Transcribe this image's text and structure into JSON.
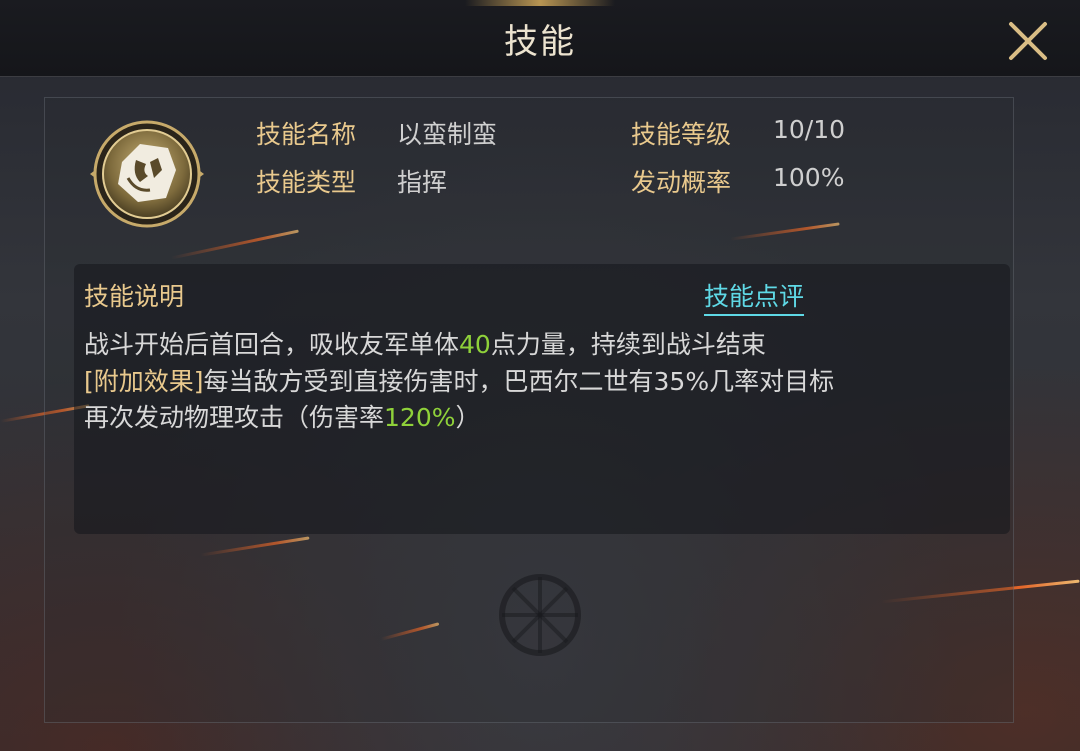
{
  "header": {
    "title": "技能",
    "close_icon": "close-icon"
  },
  "skill": {
    "icon": "skill-emblem-icon",
    "name_label": "技能名称",
    "name_value": "以蛮制蛮",
    "level_label": "技能等级",
    "level_value": "10/10",
    "type_label": "技能类型",
    "type_value": "指挥",
    "rate_label": "发动概率",
    "rate_value": "100%"
  },
  "description": {
    "title": "技能说明",
    "review_link": "技能点评",
    "line1_a": "战斗开始后首回合，吸收友军单体",
    "line1_b": "40",
    "line1_c": "点力量，持续到战斗结束",
    "line2_tag": "[附加效果]",
    "line2_text": "每当敌方受到直接伤害时，巴西尔二世有35%几率对目标",
    "line3_a": "再次发动物理攻击（伤害率",
    "line3_b": "120%",
    "line3_c": "）"
  },
  "colors": {
    "label_gold": "#e9c98d",
    "value_gray": "#cfcfcf",
    "highlight_green": "#8fd13a",
    "link_cyan": "#5fd9e6"
  }
}
